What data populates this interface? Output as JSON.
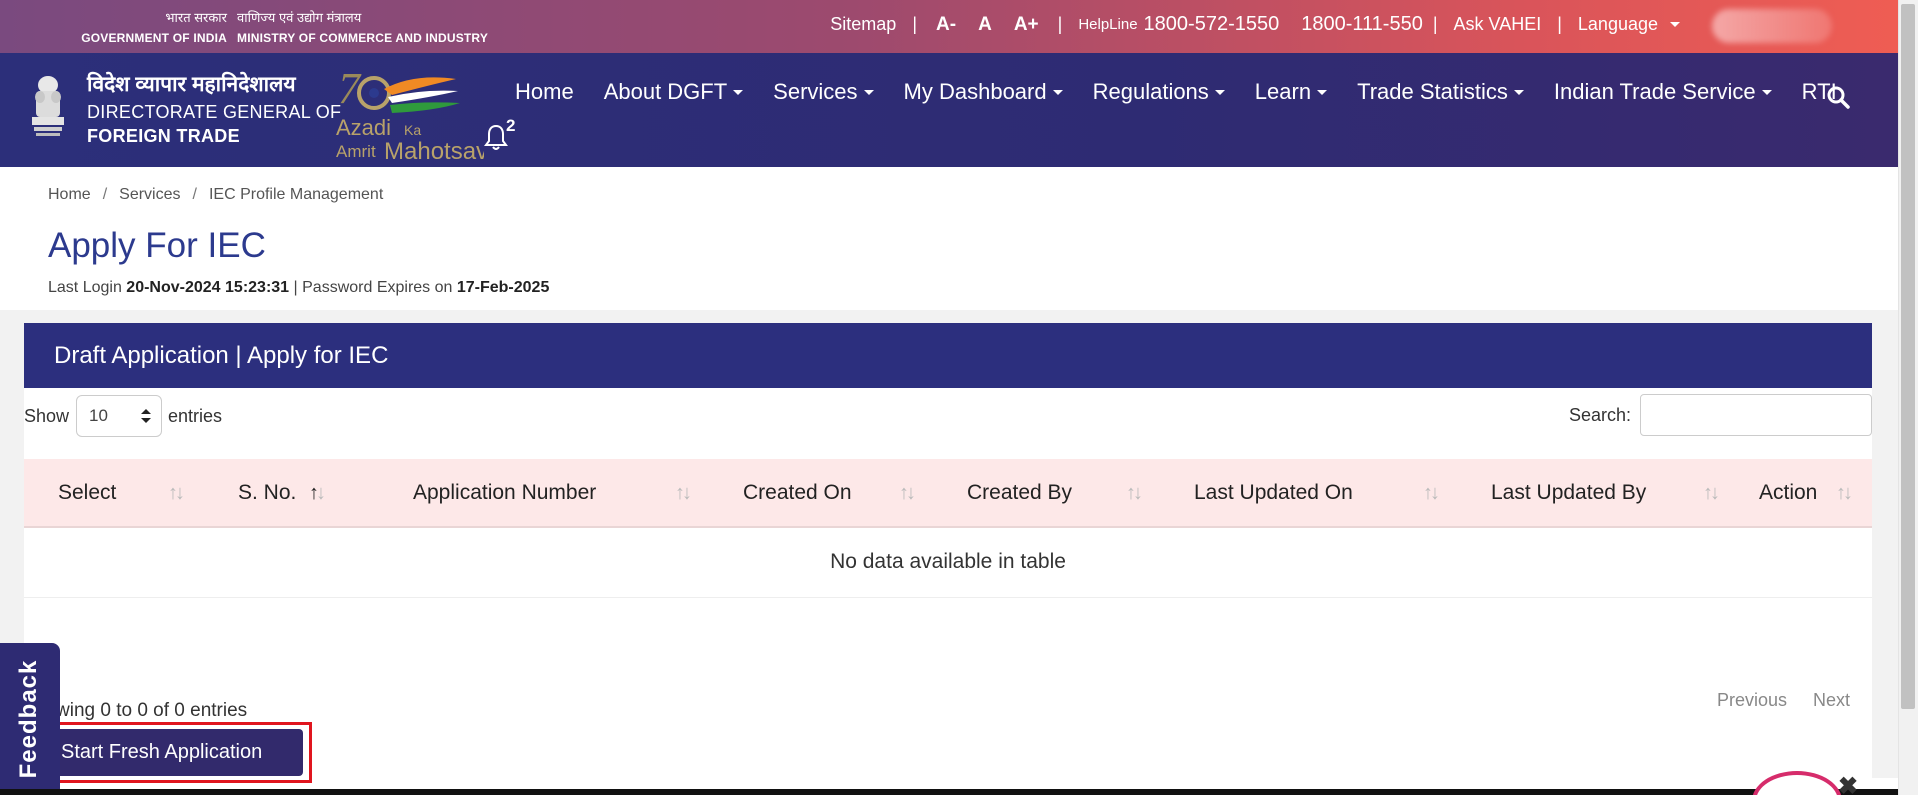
{
  "topbar": {
    "gov_hindi": "भारत सरकार",
    "gov_en": "GOVERNMENT OF INDIA",
    "ministry_hindi": "वाणिज्य एवं उद्योग मंत्रालय",
    "ministry_en": "MINISTRY OF COMMERCE AND INDUSTRY",
    "sitemap": "Sitemap",
    "font_decrease": "A-",
    "font_normal": "A",
    "font_increase": "A+",
    "helpline_label": "HelpLine",
    "phone1": "1800-572-1550",
    "phone2": "1800-111-550",
    "ask": "Ask VAHEI",
    "language": "Language",
    "sep": "|"
  },
  "brand": {
    "hindi": "विदेश व्यापार महानिदेशालय",
    "line1": "DIRECTORATE GENERAL OF",
    "line2": "FOREIGN TRADE",
    "akam_line1": "Azadi",
    "akam_ka": "Ka",
    "akam_line2": "Amrit",
    "akam_line3": "Mahotsav"
  },
  "nav": {
    "home": "Home",
    "about": "About DGFT",
    "services": "Services",
    "dashboard": "My Dashboard",
    "regulations": "Regulations",
    "learn": "Learn",
    "trade_stats": "Trade Statistics",
    "its": "Indian Trade Service",
    "rti": "RTI",
    "notification_count": "2"
  },
  "breadcrumb": [
    "Home",
    "Services",
    "IEC Profile Management"
  ],
  "page": {
    "title": "Apply For IEC",
    "last_login_label": "Last Login",
    "last_login_value": "20-Nov-2024 15:23:31",
    "pwd_label": "| Password Expires on",
    "pwd_value": "17-Feb-2025"
  },
  "panel": {
    "title": "Draft Application | Apply for IEC",
    "show_label": "Show",
    "page_length": "10",
    "entries_label": "entries",
    "search_label": "Search:",
    "columns": [
      "Select",
      "S. No.",
      "Application Number",
      "Created On",
      "Created By",
      "Last Updated On",
      "Last Updated By",
      "Action"
    ],
    "empty_message": "No data available in table",
    "info": "wing 0 to 0 of 0 entries",
    "previous": "Previous",
    "next": "Next",
    "start_button": "Start Fresh Application"
  },
  "feedback": "Feedback",
  "chat_close": "✖",
  "colors": {
    "nav_bg": "#2c2f7a",
    "accent": "#2c3a8e",
    "header_row": "#fde8e8",
    "highlight": "#e0151e"
  }
}
